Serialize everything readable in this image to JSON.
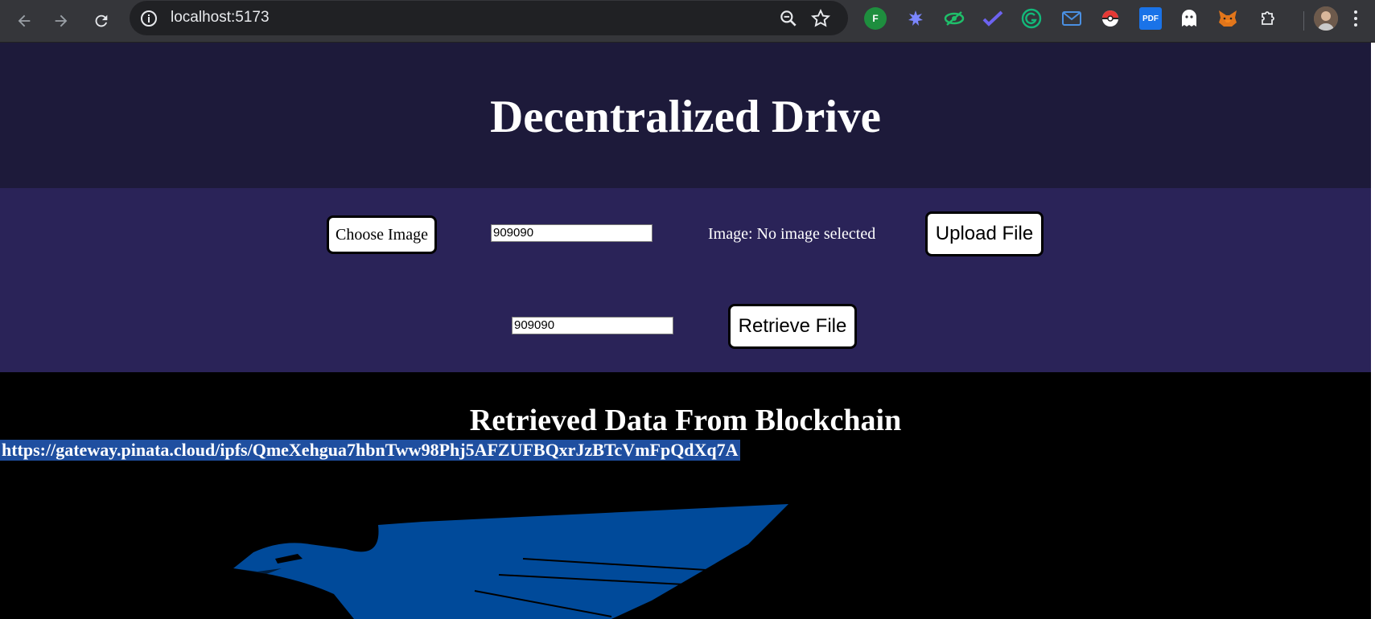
{
  "browser": {
    "url": "localhost:5173",
    "extensions": [
      "f-extension-icon",
      "puzzle-star-icon",
      "eye-shield-icon",
      "check-icon",
      "grammarly-icon",
      "mail-icon",
      "pokeball-icon",
      "pdf-icon",
      "ghost-icon",
      "metamask-fox-icon",
      "extensions-puzzle-icon"
    ],
    "pdf_label": "PDF",
    "ext_f_label": "F"
  },
  "page": {
    "title": "Decentralized Drive",
    "choose_label": "Choose Image",
    "input_value": "909090",
    "image_status": "Image: No image selected",
    "upload_label": "Upload File",
    "retrieve_input_value": "909090",
    "retrieve_label": "Retrieve File",
    "results_title": "Retrieved Data From Blockchain",
    "retrieved_link": "https://gateway.pinata.cloud/ipfs/QmeXehgua7hbnTww98Phj5AFZUFBQxrJzBTcVmFpQdXq7A"
  },
  "colors": {
    "header_bg": "#1d1a3a",
    "controls_bg": "#2a2358",
    "link_highlight": "#1f4fa0",
    "eagle": "#004a9a"
  }
}
